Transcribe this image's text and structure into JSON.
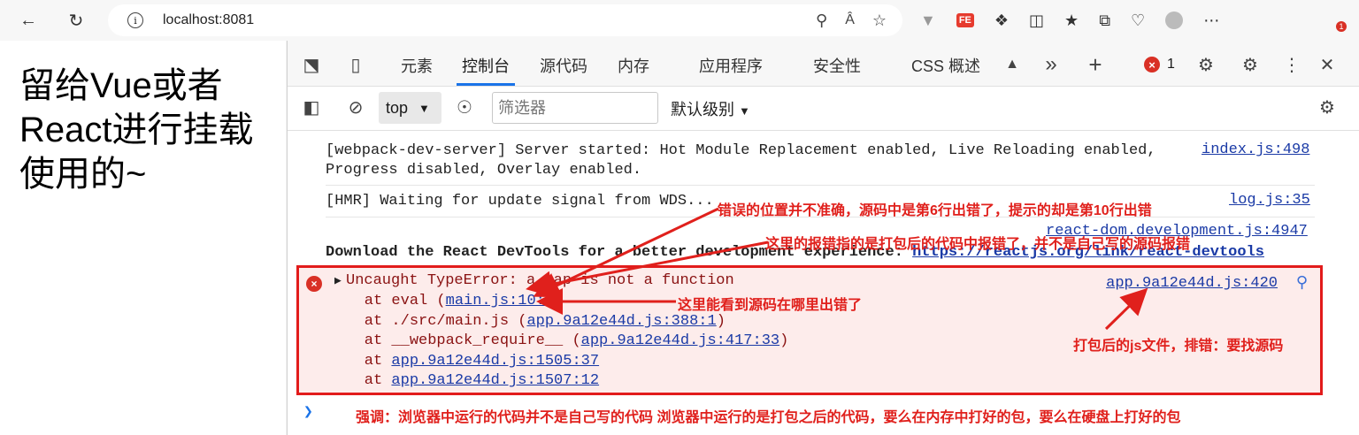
{
  "browser": {
    "url": "localhost:8081",
    "extension_badge": "FE",
    "notification_count": "1"
  },
  "viewport": {
    "headline": "留给Vue或者React进行挂载使用的~"
  },
  "devtools": {
    "tabs": [
      "元素",
      "控制台",
      "源代码",
      "内存",
      "应用程序",
      "安全性",
      "CSS 概述"
    ],
    "active_tab": "控制台",
    "error_count": "1",
    "context": "top",
    "filter_placeholder": "筛选器",
    "levels": "默认级别"
  },
  "console": {
    "msg1_line1": "[webpack-dev-server] Server started: Hot Module Replacement enabled, Live Reloading enabled,",
    "msg1_line2": "Progress disabled, Overlay enabled.",
    "msg1_src": "index.js:498",
    "msg2": "[HMR] Waiting for update signal from WDS...",
    "msg2_src": "log.js:35",
    "msg3_src": "react-dom.development.js:4947",
    "msg3_text": "Download the React DevTools for a better development experience: ",
    "msg3_link": "https://reactjs.org/link/react-devtools",
    "error": {
      "title": "Uncaught TypeError: a.map is not a function",
      "src": "app.9a12e44d.js:420",
      "stack": [
        {
          "prefix": "    at eval (",
          "link": "main.js:10:3",
          "suffix": ")"
        },
        {
          "prefix": "    at ./src/main.js (",
          "link": "app.9a12e44d.js:388:1",
          "suffix": ")"
        },
        {
          "prefix": "    at __webpack_require__ (",
          "link": "app.9a12e44d.js:417:33",
          "suffix": ")"
        },
        {
          "prefix": "    at ",
          "link": "app.9a12e44d.js:1505:37",
          "suffix": ""
        },
        {
          "prefix": "    at ",
          "link": "app.9a12e44d.js:1507:12",
          "suffix": ""
        }
      ]
    }
  },
  "annotations": {
    "note1": "错误的位置并不准确，源码中是第6行出错了，提示的却是第10行出错",
    "note2": "这里的报错指的是打包后的代码中报错了，并不是自己写的源码报错",
    "note3": "这里能看到源码在哪里出错了",
    "note4": "打包后的js文件，排错：要找源码",
    "note5": "强调：浏览器中运行的代码并不是自己写的代码  浏览器中运行的是打包之后的代码，要么在内存中打好的包，要么在硬盘上打好的包",
    "color": "#e0201c"
  }
}
